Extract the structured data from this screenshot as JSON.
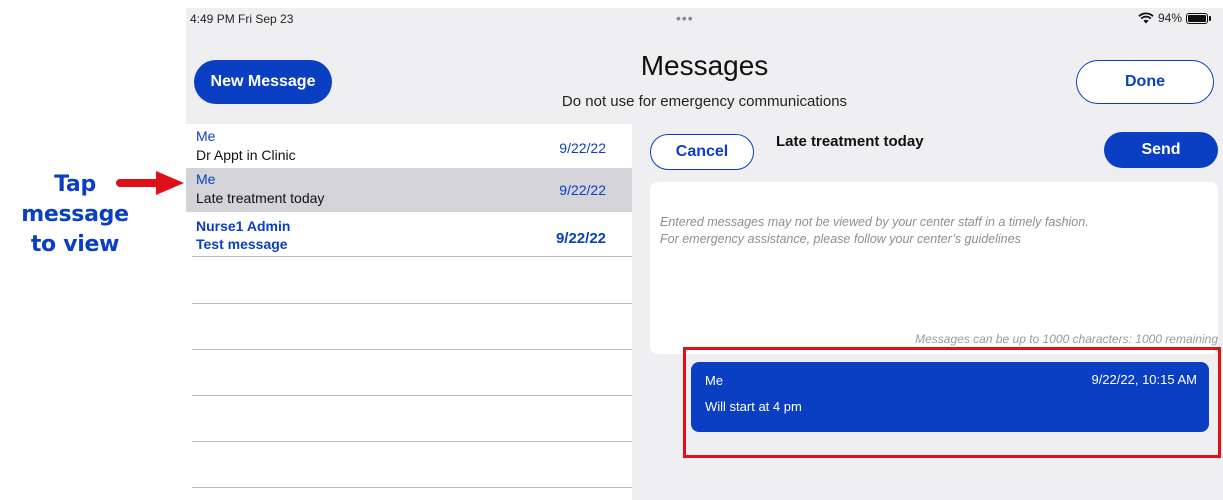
{
  "annotation": {
    "line1": "Tap",
    "line2": "message",
    "line3": "to view",
    "arrow_color": "#e0101a"
  },
  "status_bar": {
    "time": "4:49 PM  Fri Sep 23",
    "dots": "•••",
    "battery": "94%"
  },
  "header": {
    "new_message": "New Message",
    "title": "Messages",
    "subtitle": "Do not use for emergency communications",
    "done": "Done"
  },
  "messages": [
    {
      "sender": "Me",
      "subject": "Dr Appt in Clinic",
      "date": "9/22/22",
      "state": "read"
    },
    {
      "sender": "Me",
      "subject": "Late treatment today",
      "date": "9/22/22",
      "state": "selected"
    },
    {
      "sender": "Nurse1 Admin",
      "subject": "Test message",
      "date": "9/22/22",
      "state": "unread"
    }
  ],
  "compose": {
    "cancel": "Cancel",
    "title": "Late treatment today",
    "send": "Send",
    "placeholder_line1": "Entered messages may not be viewed by your center staff in a timely fashion.",
    "placeholder_line2": "For emergency assistance, please follow your center’s guidelines",
    "counter": "Messages can be up to 1000 characters: 1000 remaining"
  },
  "thread": {
    "sender": "Me",
    "timestamp": "9/22/22, 10:15 AM",
    "body": "Will start at 4 pm"
  },
  "colors": {
    "accent": "#0a3fc4",
    "highlight": "#e0101a",
    "selected_row": "#d3d3d8"
  }
}
